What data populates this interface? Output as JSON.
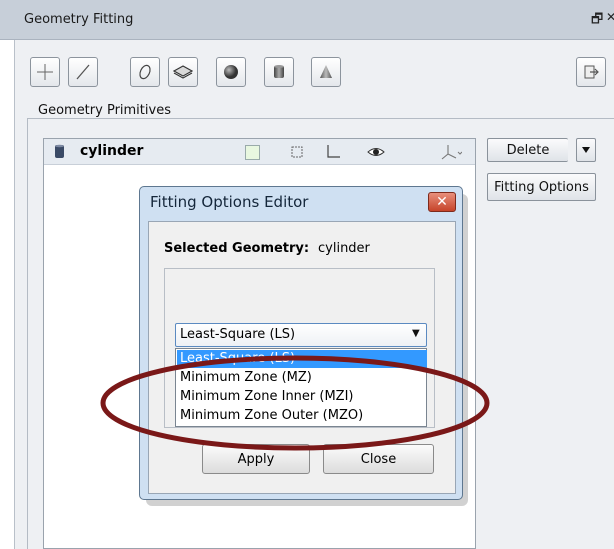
{
  "window": {
    "title": "Geometry Fitting",
    "float_glyph": "🗗",
    "close_glyph": "✕"
  },
  "toolbar": {
    "tools": [
      {
        "icon": "point-icon"
      },
      {
        "icon": "line-icon"
      },
      {
        "icon": "circle-icon"
      },
      {
        "icon": "plane-icon"
      },
      {
        "icon": "sphere-icon"
      },
      {
        "icon": "cylinder-icon"
      },
      {
        "icon": "cone-icon"
      }
    ],
    "export_icon": "export-icon"
  },
  "primitives": {
    "group_label": "Geometry Primitives",
    "items": [
      {
        "name": "cylinder",
        "icon": "cylinder-icon"
      }
    ],
    "row_icons": [
      "color-swatch-icon",
      "frame-icon",
      "axis-icon",
      "eye-icon",
      "coordinate-system-icon"
    ],
    "swatch_color": "#e8f7e0"
  },
  "buttons": {
    "delete": "Delete",
    "fitting_options": "Fitting Options"
  },
  "dialog": {
    "title": "Fitting Options Editor",
    "close_glyph": "✕",
    "selected_label": "Selected Geometry:",
    "selected_value": "cylinder",
    "method_selected": "Least-Square (LS)",
    "options": [
      "Least-Square (LS)",
      "Minimum Zone (MZ)",
      "Minimum Zone Inner (MZI)",
      "Minimum Zone Outer (MZO)"
    ],
    "highlighted_option_index": 0,
    "apply": "Apply",
    "close": "Close"
  },
  "colors": {
    "accent": "#3399ff",
    "annotation": "#7a1818"
  }
}
